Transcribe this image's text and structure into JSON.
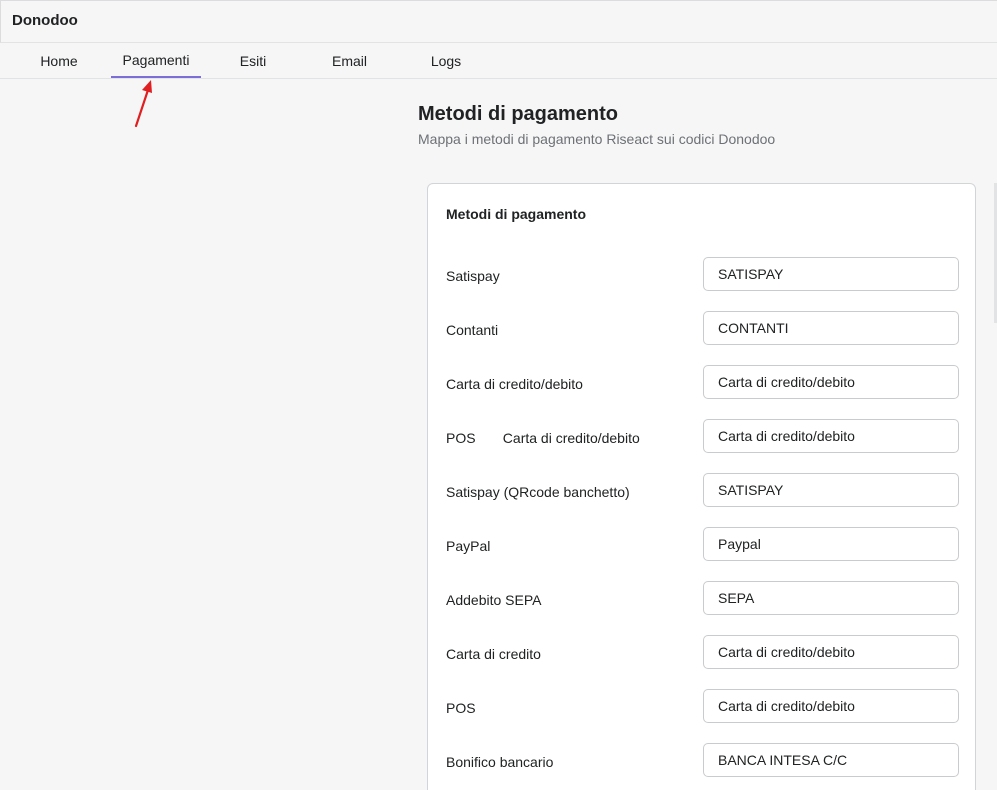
{
  "app": {
    "title": "Donodoo"
  },
  "tabs": [
    {
      "label": "Home"
    },
    {
      "label": "Pagamenti"
    },
    {
      "label": "Esiti"
    },
    {
      "label": "Email"
    },
    {
      "label": "Logs"
    }
  ],
  "active_tab": "Pagamenti",
  "page": {
    "title": "Metodi di pagamento",
    "subtitle": "Mappa i metodi di pagamento Riseact sui codici Donodoo"
  },
  "card": {
    "title": "Metodi di pagamento",
    "rows": [
      {
        "label": "Satispay",
        "value": "SATISPAY"
      },
      {
        "label": "Contanti",
        "value": "CONTANTI"
      },
      {
        "label": "Carta di credito/debito",
        "value": "Carta di credito/debito"
      },
      {
        "label": "POS       Carta di credito/debito",
        "value": "Carta di credito/debito"
      },
      {
        "label": "Satispay (QRcode banchetto)",
        "value": "SATISPAY"
      },
      {
        "label": "PayPal",
        "value": "Paypal"
      },
      {
        "label": "Addebito SEPA",
        "value": "SEPA"
      },
      {
        "label": "Carta di credito",
        "value": "Carta di credito/debito"
      },
      {
        "label": "POS",
        "value": "Carta di credito/debito"
      },
      {
        "label": "Bonifico bancario",
        "value": "BANCA INTESA C/C"
      }
    ]
  },
  "colors": {
    "accent": "#7b6ed6",
    "annotation_arrow": "#e02020",
    "background": "#f6f6f7",
    "card_border": "#d2d5d8"
  }
}
